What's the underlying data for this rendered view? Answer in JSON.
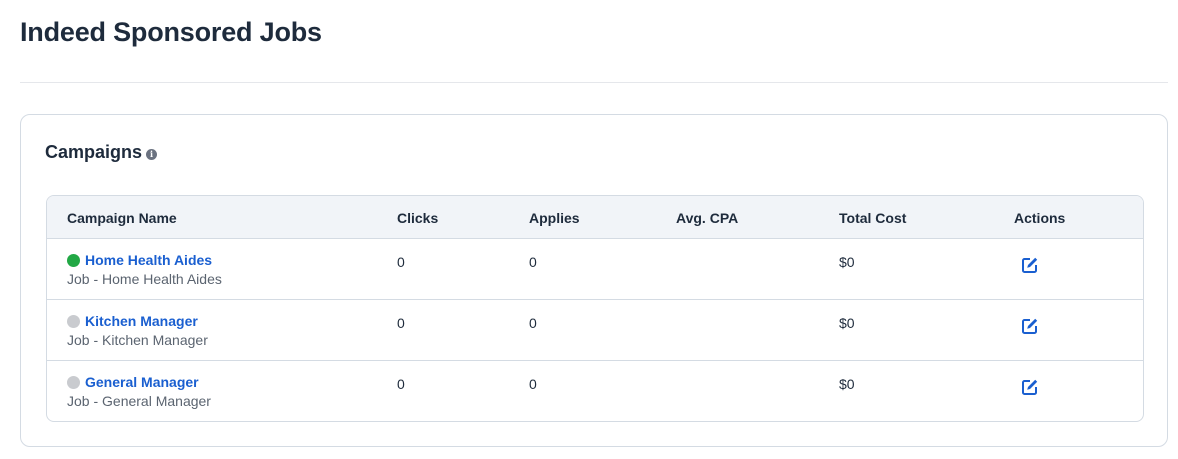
{
  "page": {
    "title": "Indeed Sponsored Jobs"
  },
  "card": {
    "title": "Campaigns",
    "info_icon": "info-icon"
  },
  "table": {
    "headers": {
      "name": "Campaign Name",
      "clicks": "Clicks",
      "applies": "Applies",
      "avg_cpa": "Avg. CPA",
      "total_cost": "Total Cost",
      "actions": "Actions"
    },
    "rows": [
      {
        "status": "active",
        "status_color": "#22a845",
        "name": "Home Health Aides",
        "subtitle": "Job - Home Health Aides",
        "clicks": "0",
        "applies": "0",
        "avg_cpa": "",
        "total_cost": "$0",
        "action_icon": "edit-icon"
      },
      {
        "status": "inactive",
        "status_color": "#c9cbcf",
        "name": "Kitchen Manager",
        "subtitle": "Job - Kitchen Manager",
        "clicks": "0",
        "applies": "0",
        "avg_cpa": "",
        "total_cost": "$0",
        "action_icon": "edit-icon"
      },
      {
        "status": "inactive",
        "status_color": "#c9cbcf",
        "name": "General Manager",
        "subtitle": "Job - General Manager",
        "clicks": "0",
        "applies": "0",
        "avg_cpa": "",
        "total_cost": "$0",
        "action_icon": "edit-icon"
      }
    ]
  },
  "colors": {
    "link": "#1a5fd0",
    "heading": "#1e2b3c",
    "header_bg": "#f1f4f8",
    "border": "#d4dbe3",
    "active": "#22a845",
    "inactive": "#c9cbcf"
  }
}
